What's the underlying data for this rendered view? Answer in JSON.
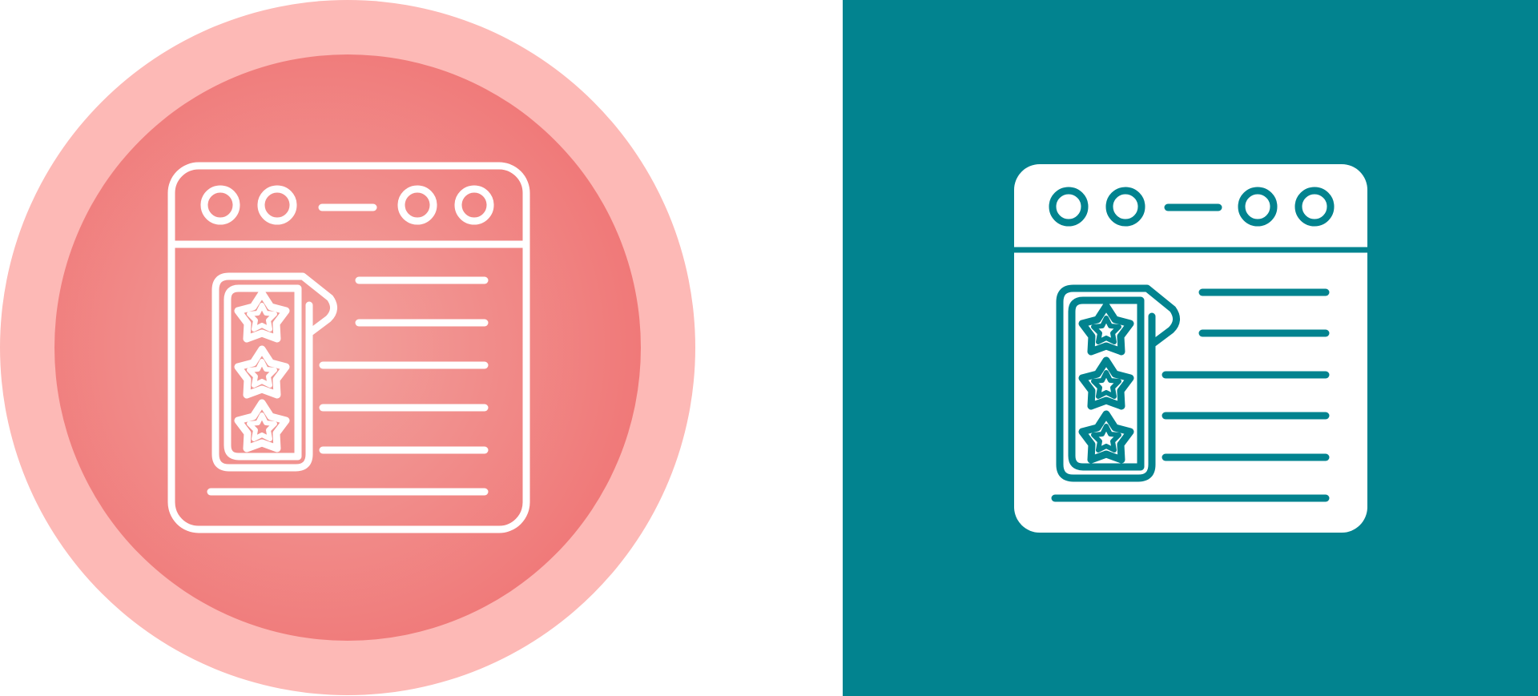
{
  "icons": [
    {
      "variant": "outline",
      "icon": "web-page-with-star-rating-icon",
      "background_shape": "circle",
      "background_colors": {
        "outer_ring": "#FDB9B6",
        "inner_gradient_start": "#F2A29E",
        "inner_gradient_end": "#F07575"
      },
      "stroke_color": "#FFFFFF",
      "rating_stars": 3
    },
    {
      "variant": "glyph",
      "icon": "web-page-with-star-rating-icon",
      "background_shape": "square",
      "background_colors": {
        "fill": "#02838F"
      },
      "glyph_fill": "#FFFFFF",
      "detail_color": "#02838F",
      "rating_stars": 3
    }
  ]
}
